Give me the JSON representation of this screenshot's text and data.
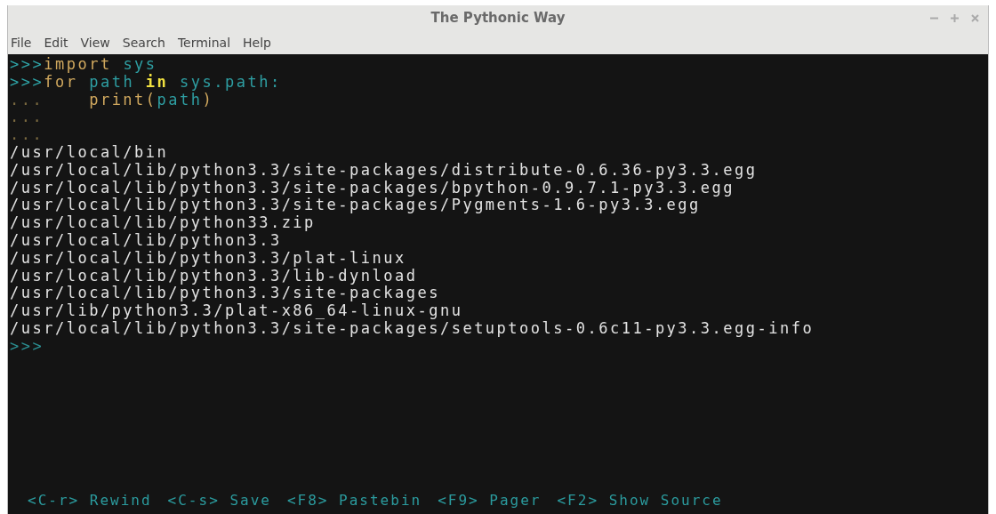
{
  "window": {
    "title": "The Pythonic Way"
  },
  "menu": [
    "File",
    "Edit",
    "View",
    "Search",
    "Terminal",
    "Help"
  ],
  "input_lines": [
    {
      "prompt": ">>>",
      "tokens": [
        {
          "text": "import ",
          "kind": "keyword"
        },
        {
          "text": "sys",
          "kind": "name"
        }
      ]
    },
    {
      "prompt": ">>>",
      "tokens": [
        {
          "text": "for ",
          "kind": "keyword"
        },
        {
          "text": "path ",
          "kind": "name"
        },
        {
          "text": "in ",
          "kind": "operator"
        },
        {
          "text": "sys.path",
          "kind": "name"
        },
        {
          "text": ":",
          "kind": "punct"
        }
      ]
    },
    {
      "prompt": "...",
      "tokens": [
        {
          "text": "    print(",
          "kind": "builtin"
        },
        {
          "text": "path",
          "kind": "name"
        },
        {
          "text": ")",
          "kind": "builtin"
        }
      ]
    },
    {
      "prompt": "..."
    },
    {
      "prompt": "..."
    }
  ],
  "output_lines": [
    "/usr/local/bin",
    "/usr/local/lib/python3.3/site-packages/distribute-0.6.36-py3.3.egg",
    "/usr/local/lib/python3.3/site-packages/bpython-0.9.7.1-py3.3.egg",
    "/usr/local/lib/python3.3/site-packages/Pygments-1.6-py3.3.egg",
    "/usr/local/lib/python33.zip",
    "/usr/local/lib/python3.3",
    "/usr/local/lib/python3.3/plat-linux",
    "/usr/local/lib/python3.3/lib-dynload",
    "/usr/local/lib/python3.3/site-packages",
    "/usr/lib/python3.3/plat-x86_64-linux-gnu",
    "/usr/local/lib/python3.3/site-packages/setuptools-0.6c11-py3.3.egg-info"
  ],
  "current_prompt": ">>>",
  "shortcuts": [
    {
      "key": "<C-r>",
      "label": "Rewind"
    },
    {
      "key": "<C-s>",
      "label": "Save"
    },
    {
      "key": "<F8>",
      "label": "Pastebin"
    },
    {
      "key": "<F9>",
      "label": "Pager"
    },
    {
      "key": "<F2>",
      "label": "Show Source"
    }
  ]
}
